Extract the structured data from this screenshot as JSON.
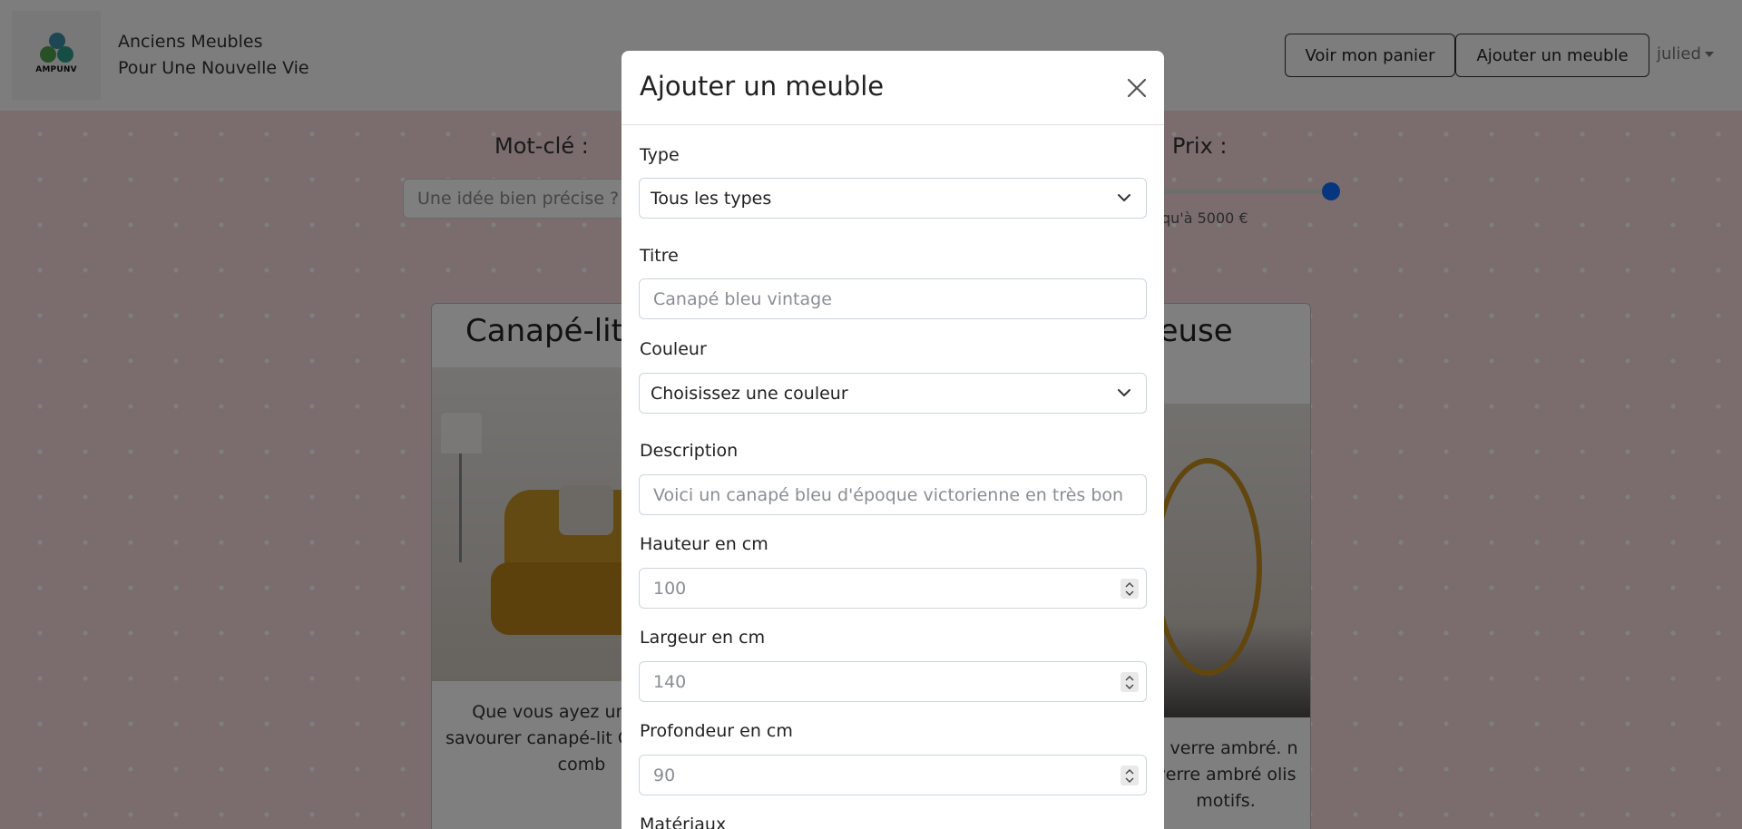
{
  "navbar": {
    "logo_text": "AMPUNV",
    "brand_line1": "Anciens Meubles",
    "brand_line2": "Pour Une Nouvelle Vie",
    "cart_button": "Voir mon panier",
    "add_button": "Ajouter un meuble",
    "user": "julied"
  },
  "filters": {
    "keyword_label": "Mot-clé :",
    "keyword_placeholder": "Une idée bien précise ?",
    "price_label": "Prix :",
    "price_range_text": "qu'à 5000 €",
    "price_slider_fraction": 1.0
  },
  "listing": {
    "card1_title": "Canapé-lit",
    "card1_text": "Que vous ayez une ou de savourer canapé-lit Cléme pour comb",
    "card2_title": "deuse",
    "card2_text": "n verre ambré. n verre ambré olis motifs."
  },
  "modal": {
    "title": "Ajouter un meuble",
    "type_label": "Type",
    "type_value": "Tous les types",
    "titre_label": "Titre",
    "titre_placeholder": "Canapé bleu vintage",
    "couleur_label": "Couleur",
    "couleur_value": "Choisissez une couleur",
    "description_label": "Description",
    "description_placeholder": "Voici un canapé bleu d'époque victorienne en très bon",
    "hauteur_label": "Hauteur en cm",
    "hauteur_placeholder": "100",
    "largeur_label": "Largeur en cm",
    "largeur_placeholder": "140",
    "profondeur_label": "Profondeur en cm",
    "profondeur_placeholder": "90",
    "materiaux_label": "Matériaux"
  },
  "colors": {
    "page_background": "#f7dadb",
    "accent_blue": "#0d6efd",
    "backdrop": "rgba(0,0,0,0.5)"
  }
}
